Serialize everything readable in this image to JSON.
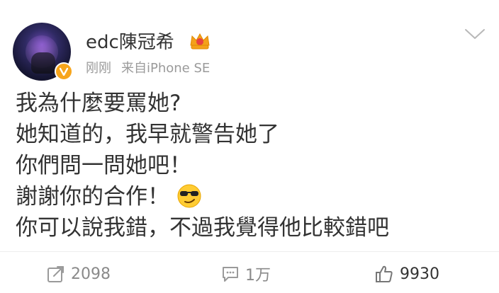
{
  "post": {
    "username": "edc陳冠希",
    "time": "刚刚",
    "source": "来自iPhone SE",
    "badge_icon": "crown-badge-icon",
    "verified_icon": "v-verified-icon",
    "lines": [
      "我為什麼要罵她?",
      "她知道的，我早就警告她了",
      "你們問一問她吧！",
      "謝謝你的合作！",
      "你可以說我錯，不過我覺得他比較錯吧"
    ],
    "emoji": "sunglasses-smirk-emoji"
  },
  "actions": {
    "repost_count": "2098",
    "comment_count": "1万",
    "like_count": "9930"
  },
  "colors": {
    "text": "#333333",
    "muted": "#9a9a9a",
    "verified_badge": "#f7a51c"
  }
}
